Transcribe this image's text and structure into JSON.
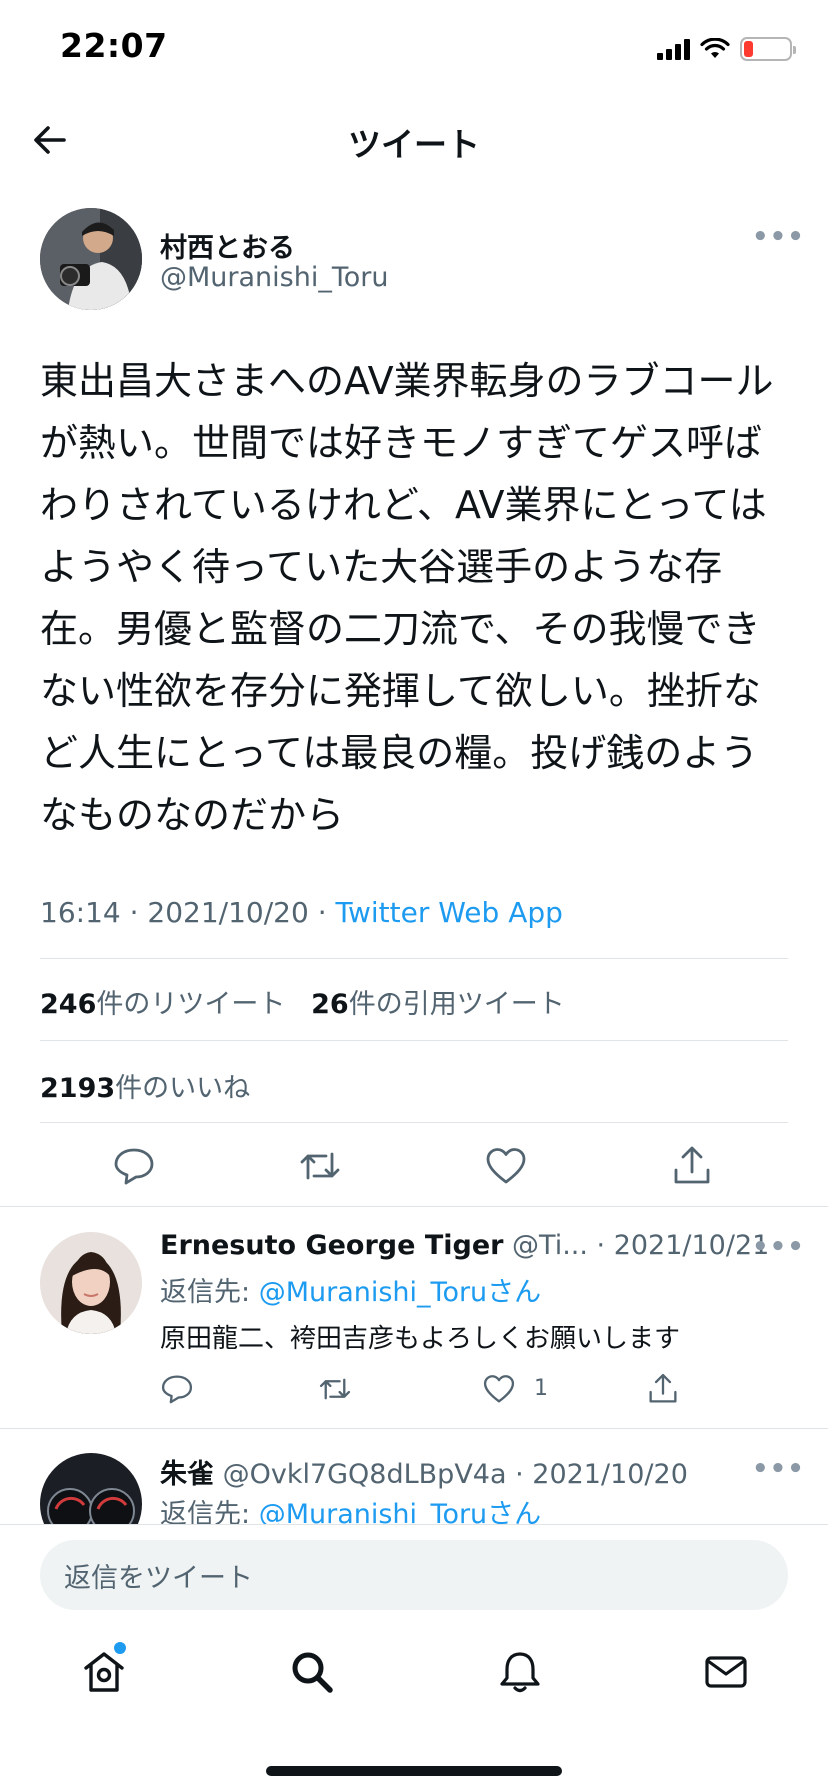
{
  "status_bar": {
    "time": "22:07",
    "battery_level_fraction": 0.2
  },
  "header": {
    "title": "ツイート"
  },
  "tweet": {
    "author_name": "村西とおる",
    "author_handle": "@Muranishi_Toru",
    "text": "東出昌大さまへのAV業界転身のラブコールが熱い。世間では好きモノすぎてゲス呼ばわりされているけれど、AV業界にとってはようやく待っていた大谷選手のような存在。男優と監督の二刀流で、その我慢できない性欲を存分に発揮して欲しい。挫折など人生にとっては最良の糧。投げ銭のようなものなのだから",
    "time": "16:14",
    "date": "2021/10/20",
    "meta_separator": " · ",
    "source": "Twitter Web App",
    "retweets_count": "246",
    "retweets_label": "件のリツイート",
    "quotes_count": "26",
    "quotes_label": "件の引用ツイート",
    "likes_count": "2193",
    "likes_label": "件のいいね"
  },
  "replies": [
    {
      "name": "Ernesuto George Tiger",
      "handle_date": " @Ti... · 2021/10/21",
      "reply_to_prefix": "返信先: ",
      "reply_to_handle": "@Muranishi_Toruさん",
      "text": "原田龍二、袴田吉彦もよろしくお願いします",
      "like_count": "1"
    },
    {
      "name": "朱雀",
      "handle_date": " @Ovkl7GQ8dLBpV4a · 2021/10/20",
      "reply_to_prefix": "返信先: ",
      "reply_to_handle": "@Muranishi_Toruさん"
    }
  ],
  "compose": {
    "placeholder": "返信をツイート"
  },
  "icons": {
    "back": "arrow-left-icon",
    "more": "more-horizontal-icon",
    "reply": "reply-icon",
    "retweet": "retweet-icon",
    "like": "heart-icon",
    "share": "share-icon",
    "home": "home-icon",
    "search": "search-icon",
    "notifications": "bell-icon",
    "messages": "mail-icon"
  },
  "colors": {
    "accent": "#1d9bf0",
    "text": "#0f1419",
    "muted": "#536471"
  }
}
